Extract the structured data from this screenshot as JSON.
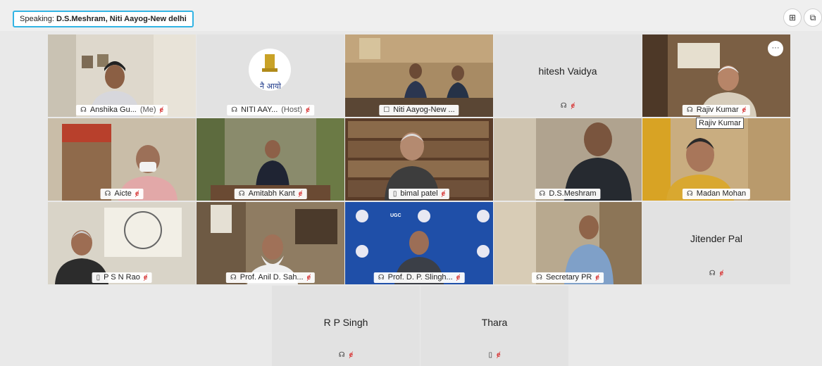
{
  "speaking": {
    "prefix": "Speaking:",
    "name": "D.S.Meshram, Niti Aayog-New delhi"
  },
  "toolbar": {
    "grid_icon": "grid-icon",
    "popout_icon": "popout-icon"
  },
  "tiles": {
    "t1": {
      "name": "Anshika Gu...",
      "suffix": "(Me)"
    },
    "t2": {
      "name": "NITI AAY...",
      "suffix": "(Host)",
      "logo_text": "नै आयो"
    },
    "t3": {
      "name": "Niti Aayog-New ..."
    },
    "t4": {
      "name": "hitesh Vaidya"
    },
    "t5": {
      "name": "Rajiv Kumar",
      "more": "···"
    },
    "t6": {
      "name": "Aicte"
    },
    "t7": {
      "name": "Amitabh Kant"
    },
    "t8": {
      "name": "bimal patel"
    },
    "t9": {
      "name": "D.S.Meshram"
    },
    "t10": {
      "name": "Madan Mohan"
    },
    "t11": {
      "name": "P S N Rao"
    },
    "t12": {
      "name": "Prof. Anil D. Sah..."
    },
    "t13": {
      "name": "Prof. D. P. Slingh...",
      "ugc": "UGC"
    },
    "t14": {
      "name": "Secretary PR"
    },
    "t15": {
      "name": "Jitender Pal"
    },
    "t16": {
      "name": "R P Singh"
    },
    "t17": {
      "name": "Thara"
    }
  },
  "tooltip": "Rajiv Kumar",
  "colors": {
    "accent": "#33b4e4",
    "mute": "#d83b3b"
  }
}
